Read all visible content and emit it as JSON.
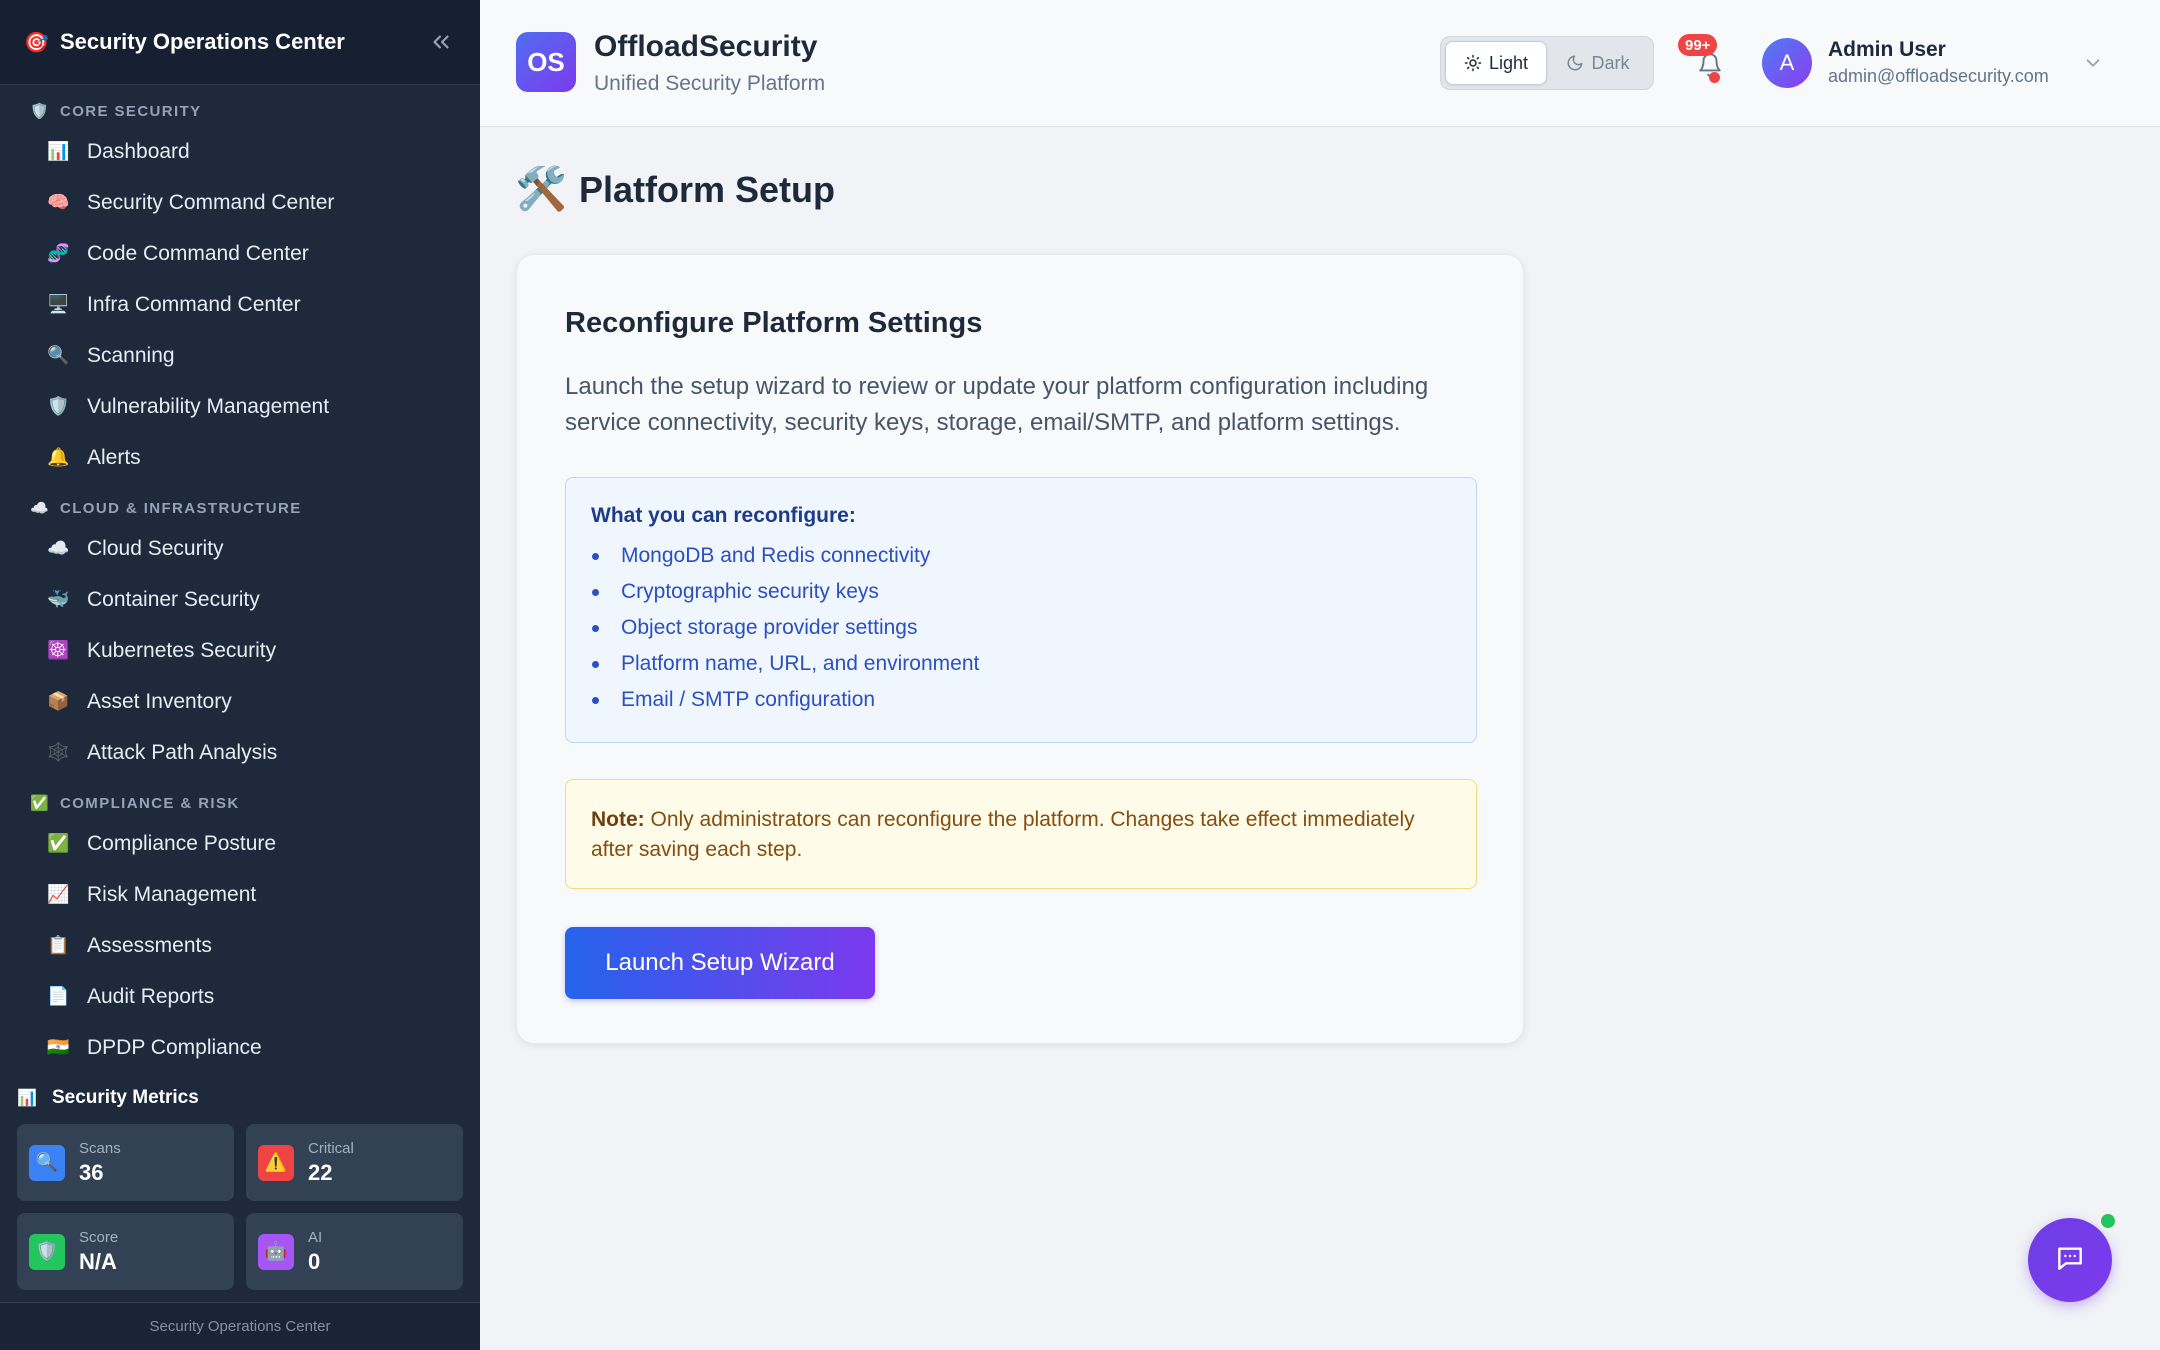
{
  "sidebar": {
    "title": "Security Operations Center",
    "logo_icon": "🎯",
    "sections": [
      {
        "label": "CORE SECURITY",
        "icon": "🛡️",
        "items": [
          {
            "icon": "📊",
            "label": "Dashboard"
          },
          {
            "icon": "🧠",
            "label": "Security Command Center"
          },
          {
            "icon": "🧬",
            "label": "Code Command Center"
          },
          {
            "icon": "🖥️",
            "label": "Infra Command Center"
          },
          {
            "icon": "🔍",
            "label": "Scanning"
          },
          {
            "icon": "🛡️",
            "label": "Vulnerability Management"
          },
          {
            "icon": "🔔",
            "label": "Alerts"
          }
        ]
      },
      {
        "label": "CLOUD & INFRASTRUCTURE",
        "icon": "☁️",
        "items": [
          {
            "icon": "☁️",
            "label": "Cloud Security"
          },
          {
            "icon": "🐳",
            "label": "Container Security"
          },
          {
            "icon": "☸️",
            "label": "Kubernetes Security"
          },
          {
            "icon": "📦",
            "label": "Asset Inventory"
          },
          {
            "icon": "🕸️",
            "label": "Attack Path Analysis"
          }
        ]
      },
      {
        "label": "COMPLIANCE & RISK",
        "icon": "✅",
        "items": [
          {
            "icon": "✅",
            "label": "Compliance Posture"
          },
          {
            "icon": "📈",
            "label": "Risk Management"
          },
          {
            "icon": "📋",
            "label": "Assessments"
          },
          {
            "icon": "📄",
            "label": "Audit Reports"
          },
          {
            "icon": "🇮🇳",
            "label": "DPDP Compliance"
          }
        ]
      }
    ],
    "metrics": {
      "title": "Security Metrics",
      "icon": "📊",
      "cards": [
        {
          "label": "Scans",
          "value": "36",
          "icon": "🔍",
          "color": "#3b82f6"
        },
        {
          "label": "Critical",
          "value": "22",
          "icon": "⚠️",
          "color": "#ef4444"
        },
        {
          "label": "Score",
          "value": "N/A",
          "icon": "🛡️",
          "color": "#22c55e"
        },
        {
          "label": "AI",
          "value": "0",
          "icon": "🤖",
          "color": "#a855f7"
        }
      ]
    },
    "footer": "Security Operations Center"
  },
  "header": {
    "brand_initials": "OS",
    "brand_name": "OffloadSecurity",
    "brand_subtitle": "Unified Security Platform",
    "theme_light": "Light",
    "theme_dark": "Dark",
    "notification_badge": "99+",
    "user_initial": "A",
    "user_name": "Admin User",
    "user_email": "admin@offloadsecurity.com"
  },
  "main": {
    "page_icon": "🛠️",
    "page_title": "Platform Setup",
    "card_title": "Reconfigure Platform Settings",
    "card_description": "Launch the setup wizard to review or update your platform configuration including service connectivity, security keys, storage, email/SMTP, and platform settings.",
    "info_title": "What you can reconfigure:",
    "info_items": [
      "MongoDB and Redis connectivity",
      "Cryptographic security keys",
      "Object storage provider settings",
      "Platform name, URL, and environment",
      "Email / SMTP configuration"
    ],
    "note_label": "Note:",
    "note_text": " Only administrators can reconfigure the platform. Changes take effect immediately after saving each step.",
    "launch_button": "Launch Setup Wizard"
  }
}
